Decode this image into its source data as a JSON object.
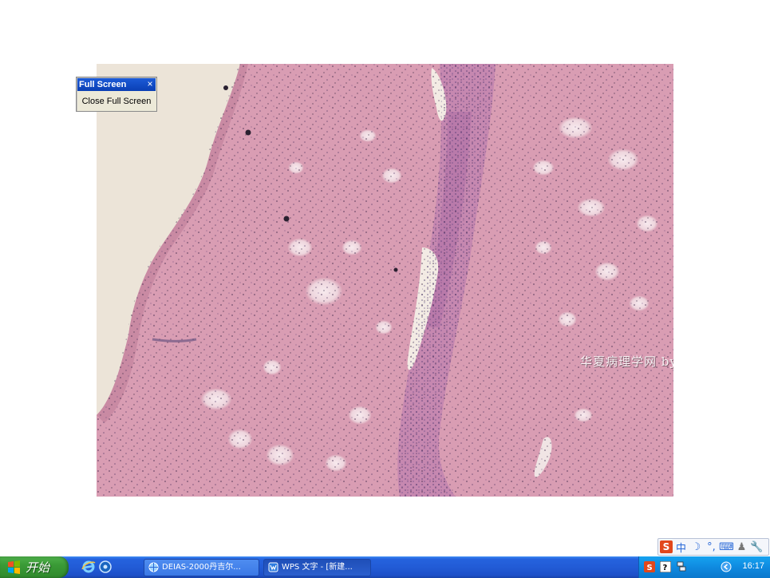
{
  "fullscreen_toolbar": {
    "title": "Full Screen",
    "close_glyph": "×",
    "button_label": "Close Full Screen"
  },
  "image": {
    "watermark": "华夏病理学网 by hyfhql"
  },
  "ime_bar": {
    "logo": "S",
    "mode": "中",
    "icons": [
      "moon-icon",
      "punctuation-icon",
      "keyboard-icon",
      "user-icon",
      "wrench-icon"
    ]
  },
  "taskbar": {
    "start_label": "开始",
    "quick_launch": [
      "ie-icon",
      "media-icon"
    ],
    "tasks": [
      {
        "label": "DEIAS-2000丹吉尔...",
        "icon": "app-globe-icon",
        "active": false
      },
      {
        "label": "WPS 文字 - [新建...",
        "icon": "wps-icon",
        "active": true
      }
    ],
    "tray_icons": [
      "sogou-icon",
      "help-icon",
      "network-icon",
      "arrow-icon"
    ],
    "clock": "16:17"
  },
  "colors": {
    "taskbar_blue": "#225bd6",
    "start_green": "#3a9a36",
    "tray_blue": "#0f8ae0",
    "tissue_pink": "#d89bb1"
  }
}
